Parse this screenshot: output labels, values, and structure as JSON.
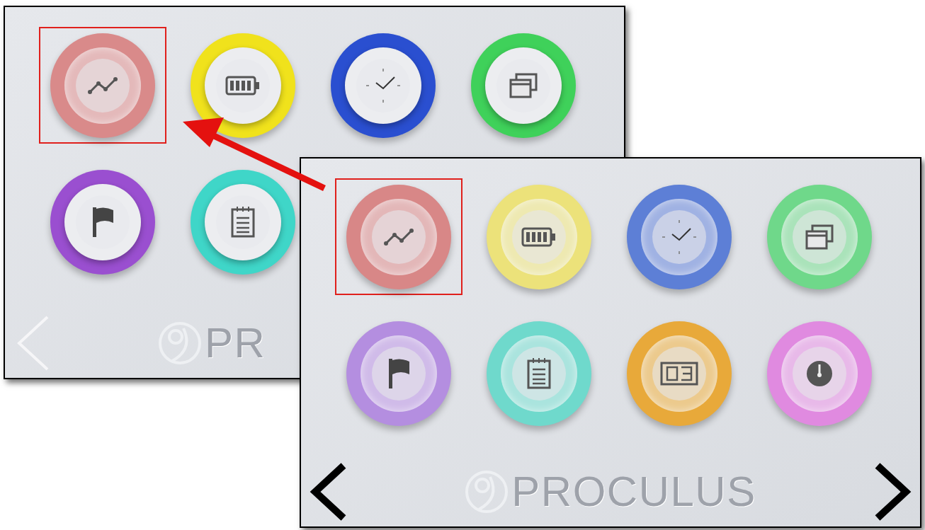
{
  "screens": [
    {
      "logo": "PR",
      "buttons": [
        {
          "kind": "chart",
          "color": "#d98a8a",
          "selected": true,
          "pressed": true
        },
        {
          "kind": "battery",
          "color": "#f0e21c",
          "selected": false,
          "pressed": false
        },
        {
          "kind": "clock",
          "color": "#2a4fd0",
          "selected": false,
          "pressed": false
        },
        {
          "kind": "windows",
          "color": "#3fd15a",
          "selected": false,
          "pressed": false
        },
        {
          "kind": "flag",
          "color": "#9a4fd0",
          "selected": false,
          "pressed": false
        },
        {
          "kind": "notepad",
          "color": "#3fd6c8",
          "selected": false,
          "pressed": false
        }
      ]
    },
    {
      "logo": "PROCULUS",
      "buttons": [
        {
          "kind": "chart",
          "color": "#d88787",
          "selected": true,
          "pressed": true
        },
        {
          "kind": "battery",
          "color": "#ece27a",
          "selected": false,
          "pressed": true
        },
        {
          "kind": "clock",
          "color": "#5d7fd6",
          "selected": false,
          "pressed": true
        },
        {
          "kind": "windows",
          "color": "#6fd88a",
          "selected": false,
          "pressed": true
        },
        {
          "kind": "flag",
          "color": "#b48ee0",
          "selected": false,
          "pressed": true
        },
        {
          "kind": "notepad",
          "color": "#6fd9cc",
          "selected": false,
          "pressed": true
        },
        {
          "kind": "digits",
          "color": "#e8a93a",
          "selected": false,
          "pressed": true
        },
        {
          "kind": "gauge",
          "color": "#e08ae0",
          "selected": false,
          "pressed": true
        }
      ]
    }
  ]
}
